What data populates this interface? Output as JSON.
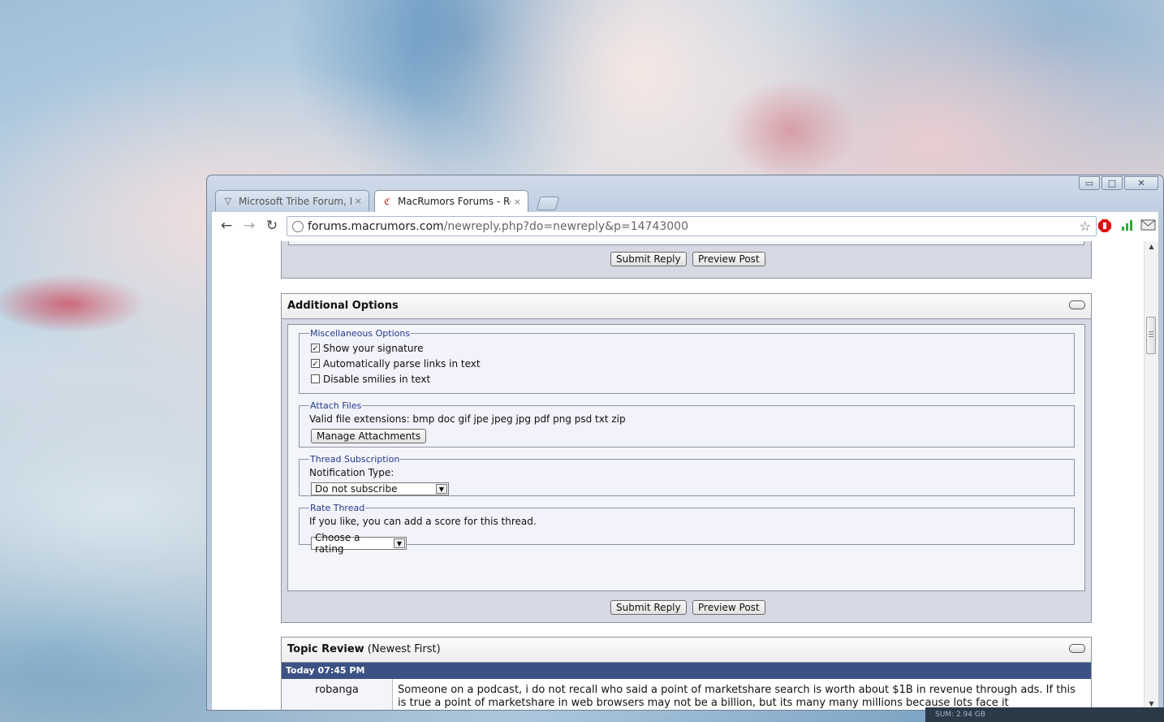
{
  "window": {
    "controls": {
      "minimize": "▭",
      "maximize": "□",
      "close": "✕"
    }
  },
  "tabs": [
    {
      "title": "Microsoft Tribe Forum, Disc",
      "icon": "▽",
      "close": "×"
    },
    {
      "title": "MacRumors Forums - Reply",
      "icon": "ℭ",
      "close": "×"
    }
  ],
  "toolbar": {
    "back": "←",
    "forward": "→",
    "reload": "↻",
    "url_host": "forums.macrumors.com",
    "url_path": "/newreply.php?do=newreply&p=14743000",
    "star": "☆"
  },
  "buttons": {
    "submit_reply": "Submit Reply",
    "preview_post": "Preview Post"
  },
  "additional_options": {
    "title": "Additional Options",
    "misc": {
      "legend": "Miscellaneous Options",
      "items": [
        {
          "label": "Show your signature",
          "checked": "✓"
        },
        {
          "label": "Automatically parse links in text",
          "checked": "✓"
        },
        {
          "label": "Disable smilies in text",
          "checked": ""
        }
      ]
    },
    "attach": {
      "legend": "Attach Files",
      "valid_ext": "Valid file extensions: bmp doc gif jpe jpeg jpg pdf png psd txt zip",
      "manage_button": "Manage Attachments"
    },
    "subscription": {
      "legend": "Thread Subscription",
      "label": "Notification Type:",
      "selected": "Do not subscribe"
    },
    "rate": {
      "legend": "Rate Thread",
      "text": "If you like, you can add a score for this thread.",
      "selected": "Choose a rating"
    }
  },
  "topic_review": {
    "title": "Topic Review",
    "subtitle": "(Newest First)",
    "date": "Today 07:45 PM",
    "post": {
      "user": "robanga",
      "text": "Someone on a podcast, i do not recall who said a point of marketshare search is worth about $1B in revenue through ads. If this is true a point of marketshare in web browsers may not be a billion, but its many many millions because lots face it"
    }
  },
  "taskbar": {
    "text": "SUM: 2.94 GB"
  }
}
